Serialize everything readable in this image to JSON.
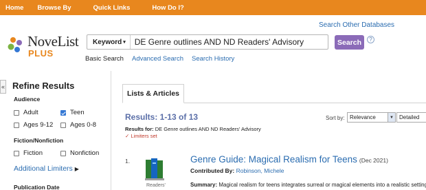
{
  "nav": {
    "items": [
      {
        "label": "Home",
        "has_caret": false
      },
      {
        "label": "Browse By",
        "has_caret": false
      },
      {
        "label": "Quick Links",
        "has_caret": false
      },
      {
        "label": "How Do I?",
        "has_caret": false
      }
    ]
  },
  "logo": {
    "word": "NoveList",
    "plus": "PLUS"
  },
  "header": {
    "search_other": "Search Other Databases"
  },
  "search": {
    "field": "Keyword",
    "query": "DE Genre outlines AND ND Readers' Advisory",
    "button": "Search",
    "help": "?",
    "basic": "Basic Search",
    "advanced": "Advanced Search",
    "history": "Search History"
  },
  "refine": {
    "collapse": "«",
    "title": "Refine Results",
    "audience_head": "Audience",
    "audience": [
      {
        "label": "Adult",
        "checked": false
      },
      {
        "label": "Teen",
        "checked": true
      },
      {
        "label": "Ages 9-12",
        "checked": false
      },
      {
        "label": "Ages 0-8",
        "checked": false
      }
    ],
    "fiction_head": "Fiction/Nonfiction",
    "fiction": [
      {
        "label": "Fiction",
        "checked": false
      },
      {
        "label": "Nonfiction",
        "checked": false
      }
    ],
    "additional": "Additional Limiters",
    "pubdate_head": "Publication Date"
  },
  "tabs": {
    "active": "Lists & Articles"
  },
  "results": {
    "count": "Results: 1-13 of 13",
    "for_label": "Results for:",
    "for_value": "DE Genre outlines AND ND Readers' Advisory",
    "limiters": "✓ Limiters set",
    "sort_label": "Sort by:",
    "sort_value": "Relevance",
    "view_value": "Detailed"
  },
  "items": [
    {
      "num": "1.",
      "title": "Genre Guide: Magical Realism for Teens",
      "date": "(Dec 2021)",
      "contrib_label": "Contributed By:",
      "author": "Robinson, Michele",
      "book_caption": "Readers'",
      "summary_label": "Summary:",
      "summary": "Magical realism for teens integrates surreal or magical elements into a realistic setting."
    }
  ],
  "colors": {
    "nav_bg": "#e8871e",
    "search_button": "#8b6bb8",
    "link": "#2a6cb0",
    "results_count": "#5b6fa8"
  }
}
